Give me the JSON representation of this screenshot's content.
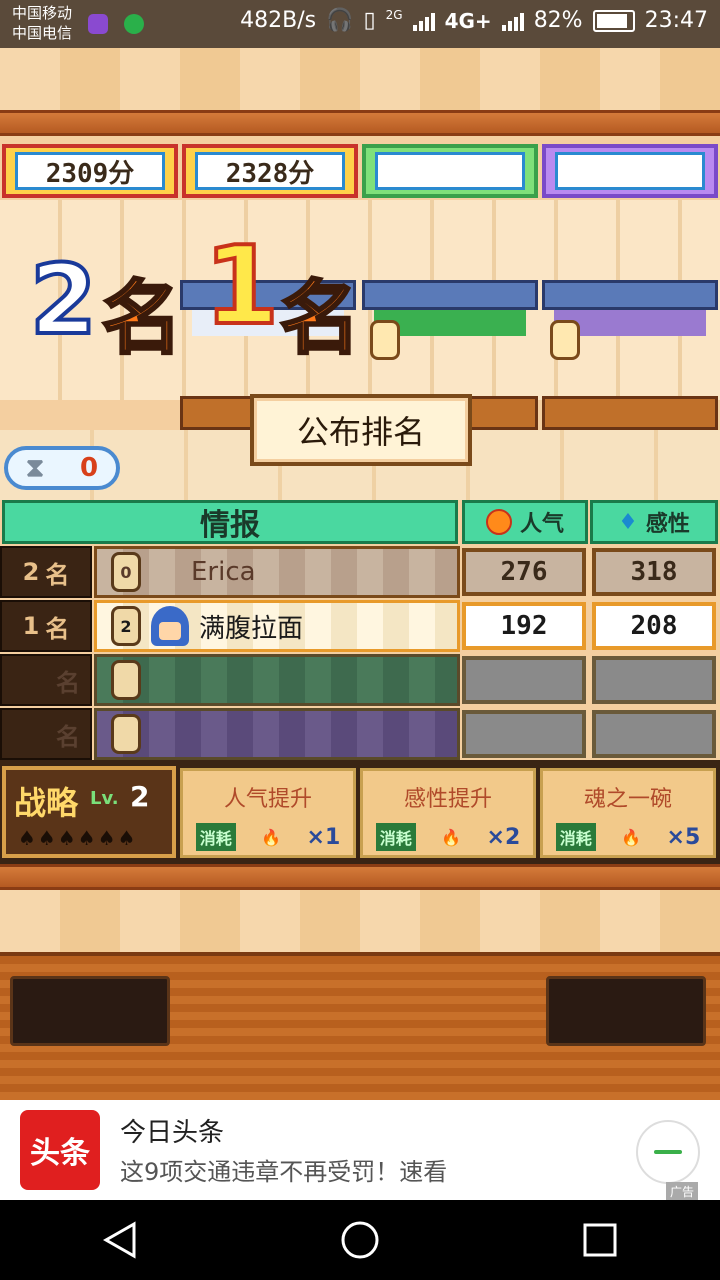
{
  "status_bar": {
    "carrier1": "中国移动",
    "carrier2": "中国电信",
    "net_speed": "482B/s",
    "net1": "2G",
    "net2": "4G+",
    "battery": "82%",
    "time": "23:47"
  },
  "scores": [
    "2309分",
    "2328分",
    "",
    ""
  ],
  "ranks": {
    "second": "2",
    "second_suffix": "名",
    "first": "1",
    "first_suffix": "名"
  },
  "announce_label": "公布排名",
  "timer": {
    "icon": "hourglass-icon",
    "value": "0"
  },
  "table": {
    "info_header": "情报",
    "popularity_header": "人气",
    "sense_header": "感性",
    "rows": [
      {
        "rank": "2",
        "rank_suffix": "名",
        "bowl": "0",
        "name": "Erica",
        "popularity": "276",
        "sense": "318"
      },
      {
        "rank": "1",
        "rank_suffix": "名",
        "bowl": "2",
        "name": "满腹拉面",
        "popularity": "192",
        "sense": "208"
      },
      {
        "rank": "",
        "rank_suffix": "名",
        "bowl": "",
        "name": "",
        "popularity": "",
        "sense": ""
      },
      {
        "rank": "",
        "rank_suffix": "名",
        "bowl": "",
        "name": "",
        "popularity": "",
        "sense": ""
      }
    ]
  },
  "strategy": {
    "label": "战略",
    "level_prefix": "Lv.",
    "level": "2"
  },
  "skills": [
    {
      "name": "人气提升",
      "cost_tag": "消耗",
      "times": "×1"
    },
    {
      "name": "感性提升",
      "cost_tag": "消耗",
      "times": "×2"
    },
    {
      "name": "魂之一碗",
      "cost_tag": "消耗",
      "times": "×5"
    }
  ],
  "ad": {
    "logo": "头条",
    "title": "今日头条",
    "text": "这9项交通违章不再受罚！速看",
    "mark": "广告"
  },
  "colors": {
    "accent_green": "#3ad08a",
    "rank_gold": "#ffd14a",
    "ad_red": "#e01f1f"
  }
}
